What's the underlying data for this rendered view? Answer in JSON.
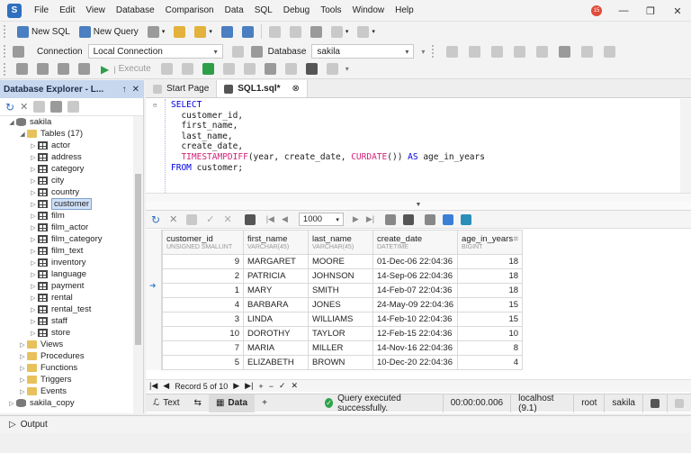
{
  "menu": [
    "File",
    "Edit",
    "View",
    "Database",
    "Comparison",
    "Data",
    "SQL",
    "Debug",
    "Tools",
    "Window",
    "Help"
  ],
  "notification_count": "15",
  "toolbar1": {
    "new_sql": "New SQL",
    "new_query": "New Query"
  },
  "toolbar2": {
    "connection_label": "Connection",
    "connection_value": "Local Connection",
    "database_label": "Database",
    "database_value": "sakila"
  },
  "toolbar3": {
    "execute": "Execute"
  },
  "explorer": {
    "title": "Database Explorer - L...",
    "tree": [
      {
        "label": "sakila",
        "level": 1,
        "icon": "db",
        "toggle": "open"
      },
      {
        "label": "Tables (17)",
        "level": 2,
        "icon": "folder",
        "toggle": "open"
      },
      {
        "label": "actor",
        "level": 3,
        "icon": "table",
        "toggle": "closed"
      },
      {
        "label": "address",
        "level": 3,
        "icon": "table",
        "toggle": "closed"
      },
      {
        "label": "category",
        "level": 3,
        "icon": "table",
        "toggle": "closed"
      },
      {
        "label": "city",
        "level": 3,
        "icon": "table",
        "toggle": "closed"
      },
      {
        "label": "country",
        "level": 3,
        "icon": "table",
        "toggle": "closed"
      },
      {
        "label": "customer",
        "level": 3,
        "icon": "table",
        "toggle": "closed",
        "selected": true
      },
      {
        "label": "film",
        "level": 3,
        "icon": "table",
        "toggle": "closed"
      },
      {
        "label": "film_actor",
        "level": 3,
        "icon": "table",
        "toggle": "closed"
      },
      {
        "label": "film_category",
        "level": 3,
        "icon": "table",
        "toggle": "closed"
      },
      {
        "label": "film_text",
        "level": 3,
        "icon": "table",
        "toggle": "closed"
      },
      {
        "label": "inventory",
        "level": 3,
        "icon": "table",
        "toggle": "closed"
      },
      {
        "label": "language",
        "level": 3,
        "icon": "table",
        "toggle": "closed"
      },
      {
        "label": "payment",
        "level": 3,
        "icon": "table",
        "toggle": "closed"
      },
      {
        "label": "rental",
        "level": 3,
        "icon": "table",
        "toggle": "closed"
      },
      {
        "label": "rental_test",
        "level": 3,
        "icon": "table",
        "toggle": "closed"
      },
      {
        "label": "staff",
        "level": 3,
        "icon": "table",
        "toggle": "closed"
      },
      {
        "label": "store",
        "level": 3,
        "icon": "table",
        "toggle": "closed"
      },
      {
        "label": "Views",
        "level": 2,
        "icon": "folder",
        "toggle": "closed"
      },
      {
        "label": "Procedures",
        "level": 2,
        "icon": "folder",
        "toggle": "closed"
      },
      {
        "label": "Functions",
        "level": 2,
        "icon": "folder",
        "toggle": "closed"
      },
      {
        "label": "Triggers",
        "level": 2,
        "icon": "folder",
        "toggle": "closed"
      },
      {
        "label": "Events",
        "level": 2,
        "icon": "folder",
        "toggle": "closed"
      },
      {
        "label": "sakila_copy",
        "level": 1,
        "icon": "db",
        "toggle": "closed"
      }
    ]
  },
  "tabs": [
    {
      "label": "Start Page",
      "active": false
    },
    {
      "label": "SQL1.sql*",
      "active": true
    }
  ],
  "sql_lines": [
    [
      {
        "t": "SELECT",
        "c": "kw"
      }
    ],
    [
      {
        "t": "  customer_id,",
        "c": ""
      }
    ],
    [
      {
        "t": "  first_name,",
        "c": ""
      }
    ],
    [
      {
        "t": "  last_name,",
        "c": ""
      }
    ],
    [
      {
        "t": "  create_date,",
        "c": ""
      }
    ],
    [
      {
        "t": "  ",
        "c": ""
      },
      {
        "t": "TIMESTAMPDIFF",
        "c": "fn"
      },
      {
        "t": "(year, create_date, ",
        "c": ""
      },
      {
        "t": "CURDATE",
        "c": "fn"
      },
      {
        "t": "()) ",
        "c": ""
      },
      {
        "t": "AS",
        "c": "kw"
      },
      {
        "t": " age_in_years",
        "c": ""
      }
    ],
    [
      {
        "t": "FROM",
        "c": "kw"
      },
      {
        "t": " customer;",
        "c": ""
      }
    ]
  ],
  "pager": {
    "page_size": "1000"
  },
  "grid": {
    "columns": [
      {
        "name": "customer_id",
        "type": "UNSIGNED SMALLINT"
      },
      {
        "name": "first_name",
        "type": "VARCHAR(45)"
      },
      {
        "name": "last_name",
        "type": "VARCHAR(45)"
      },
      {
        "name": "create_date",
        "type": "DATETIME"
      },
      {
        "name": "age_in_years",
        "type": "BIGINT"
      }
    ],
    "rows": [
      [
        "9",
        "MARGARET",
        "MOORE",
        "01-Dec-06 22:04:36",
        "18"
      ],
      [
        "2",
        "PATRICIA",
        "JOHNSON",
        "14-Sep-06 22:04:36",
        "18"
      ],
      [
        "1",
        "MARY",
        "SMITH",
        "14-Feb-07 22:04:36",
        "18"
      ],
      [
        "4",
        "BARBARA",
        "JONES",
        "24-May-09 22:04:36",
        "15"
      ],
      [
        "3",
        "LINDA",
        "WILLIAMS",
        "14-Feb-10 22:04:36",
        "15"
      ],
      [
        "10",
        "DOROTHY",
        "TAYLOR",
        "12-Feb-15 22:04:36",
        "10"
      ],
      [
        "7",
        "MARIA",
        "MILLER",
        "14-Nov-16 22:04:36",
        "8"
      ],
      [
        "5",
        "ELIZABETH",
        "BROWN",
        "10-Dec-20 22:04:36",
        "4"
      ]
    ],
    "record_status": "Record 5 of 10"
  },
  "status": {
    "text_tab": "Text",
    "data_tab": "Data",
    "message": "Query executed successfully.",
    "elapsed": "00:00:00.006",
    "server": "localhost (9.1)",
    "user": "root",
    "database": "sakila"
  },
  "output_label": "Output"
}
